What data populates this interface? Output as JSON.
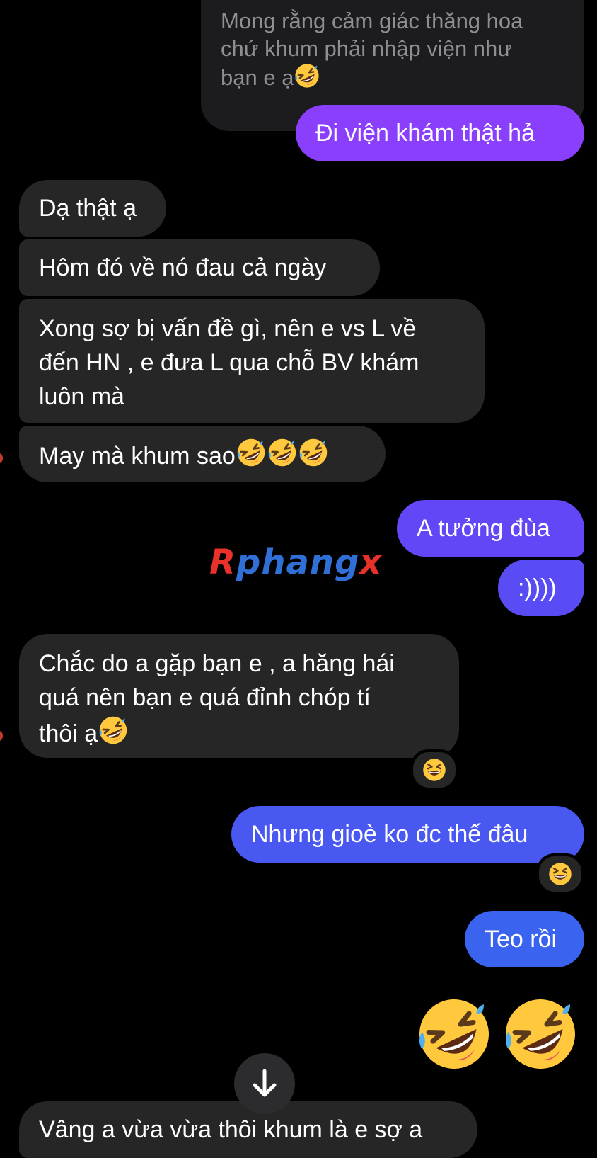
{
  "messages": {
    "reply_preview": [
      "Mong rằng cảm giác thăng hoa",
      "chứ khum phải nhập viện như",
      "bạn e ạ"
    ],
    "m1": "Đi viện khám thật hả",
    "m2": "Dạ thật ạ",
    "m3": "Hôm đó về nó đau cả ngày",
    "m4": [
      "Xong sợ bị vấn đề gì, nên e vs L về",
      "đến HN , e đưa L qua chỗ BV khám",
      "luôn mà"
    ],
    "m5": "May mà khum sao",
    "m6": "A tưởng đùa",
    "m7": ":))))",
    "m8": [
      "Chắc do a gặp bạn e , a hăng hái",
      "quá nên bạn e quá đỉnh chóp tí",
      "thôi ạ"
    ],
    "m9": "Nhưng gioè ko đc thế đâu",
    "m10": "Teo rồi",
    "m11": "Vâng a vừa vừa thôi khum là e sợ a"
  },
  "watermark": {
    "r": "R",
    "p": "phang",
    "x": "x"
  },
  "icons": {
    "laugh": "rolling-on-floor-laughing-emoji",
    "react": "grinning-squinting-face-emoji",
    "scroll": "arrow-down-icon"
  },
  "colors": {
    "bubble_in": "#262626",
    "out_top": "#8a3ffc",
    "out_mid": "#5b4cf5",
    "out_bottom": "#3a63f0",
    "background": "#000000"
  }
}
